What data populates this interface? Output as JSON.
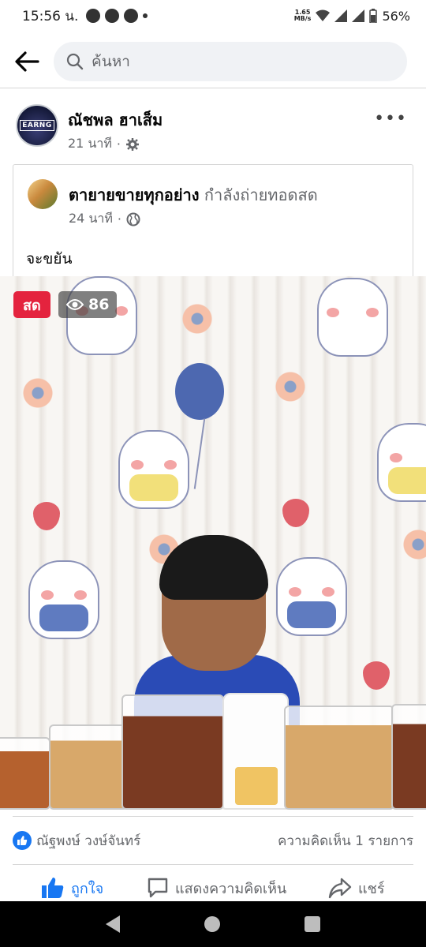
{
  "status_bar": {
    "time": "15:56 น.",
    "net_speed_value": "1.65",
    "net_speed_unit": "MB/s",
    "battery": "56%"
  },
  "search": {
    "placeholder": "ค้นหา"
  },
  "post": {
    "author": "ณัชพล ฮาเส็ม",
    "time": "21 นาที",
    "avatar_text": "EARNG",
    "shared": {
      "author": "ตายายขายทุกอย่าง",
      "activity": "กำลังถ่ายทอดสด",
      "time": "24 นาที",
      "text": "จะขยัน"
    },
    "video": {
      "live_label": "สด",
      "viewer_count": "86"
    },
    "reactions": {
      "liked_by": "ณัฐพงษ์ วงษ์จันทร์",
      "comments": "ความคิดเห็น 1 รายการ"
    },
    "actions": {
      "like": "ถูกใจ",
      "comment": "แสดงความคิดเห็น",
      "share": "แชร์"
    }
  },
  "colors": {
    "accent": "#1877f2",
    "live_red": "#e4233e"
  }
}
